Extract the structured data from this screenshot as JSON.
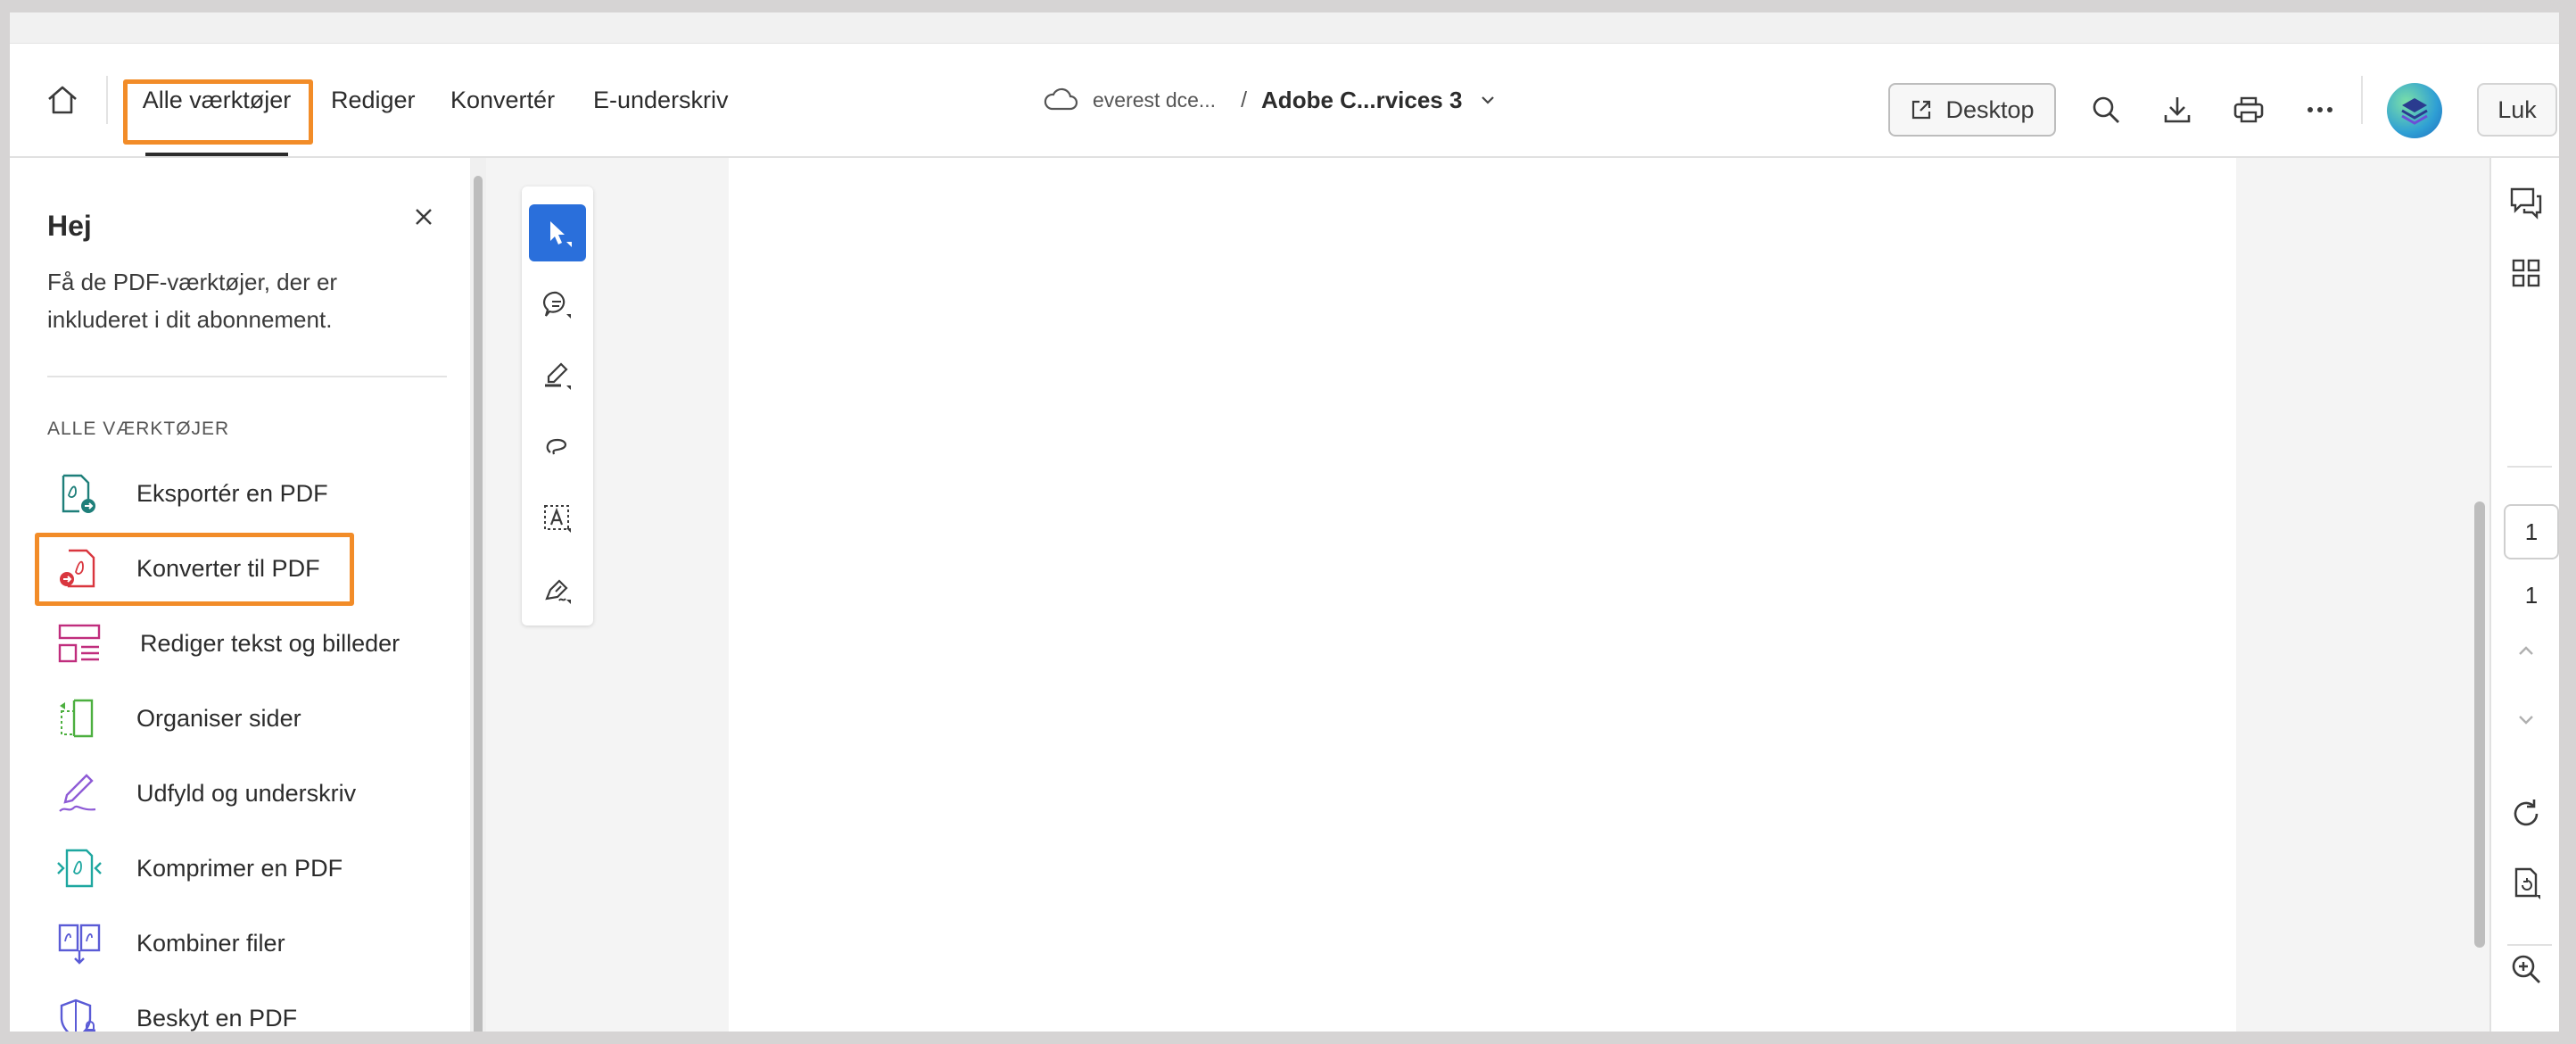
{
  "header": {
    "tabs": [
      {
        "label": "Alle værktøjer",
        "active": true
      },
      {
        "label": "Rediger"
      },
      {
        "label": "Konvertér"
      },
      {
        "label": "E-underskriv"
      }
    ],
    "breadcrumb": {
      "location": "everest dce...",
      "separator": "/",
      "filename": "Adobe C...rvices 3"
    },
    "desktop_label": "Desktop",
    "close_label": "Luk"
  },
  "panel": {
    "title": "Hej",
    "description": "Få de PDF-værktøjer, der er inkluderet i dit abonnement.",
    "section_label": "ALLE VÆRKTØJER",
    "tools": [
      {
        "label": "Eksportér en PDF",
        "icon": "export-pdf-icon",
        "color": "#1e7f7a"
      },
      {
        "label": "Konverter til PDF",
        "icon": "convert-to-pdf-icon",
        "color": "#d9363e"
      },
      {
        "label": "Rediger tekst og billeder",
        "icon": "edit-text-images-icon",
        "color": "#c02d7d"
      },
      {
        "label": "Organiser sider",
        "icon": "organize-pages-icon",
        "color": "#4caf3f"
      },
      {
        "label": "Udfyld og underskriv",
        "icon": "fill-sign-icon",
        "color": "#8e5bd6"
      },
      {
        "label": "Komprimer en PDF",
        "icon": "compress-pdf-icon",
        "color": "#1ea7a0"
      },
      {
        "label": "Kombiner filer",
        "icon": "combine-files-icon",
        "color": "#5a5bd6"
      },
      {
        "label": "Beskyt en PDF",
        "icon": "protect-pdf-icon",
        "color": "#5a5bd6"
      }
    ]
  },
  "page_nav": {
    "current": "1",
    "total": "1"
  },
  "colors": {
    "accent": "#2a6fdb",
    "highlight": "#f28c28"
  }
}
